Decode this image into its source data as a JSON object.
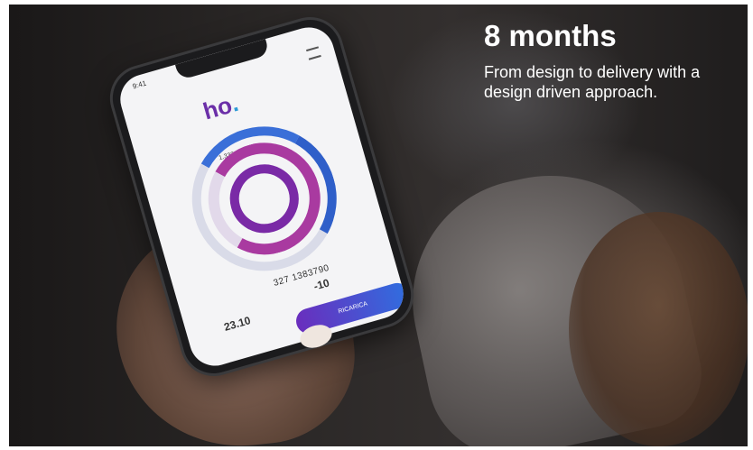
{
  "overlay": {
    "headline": "8 months",
    "subhead": "From design to delivery with a design driven approach."
  },
  "phone": {
    "status_time": "9:41",
    "logo_text": "ho",
    "logo_dot": ".",
    "ring_labels": [
      "21",
      "1.332"
    ],
    "number": "327 1383790",
    "stat_left_value": "23.10",
    "stat_right_value": "-10",
    "cta_label": "RICARICA"
  },
  "colors": {
    "brand_purple": "#6b2fa8",
    "brand_blue": "#2f6fe0",
    "headline_text": "#ffffff"
  },
  "icons": [
    "menu-icon"
  ]
}
